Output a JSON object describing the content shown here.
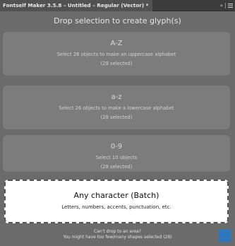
{
  "window": {
    "tab_title": "Fontself Maker 3.5.8 – Untitled – Regular (Vector) *",
    "collapse_glyph": "»",
    "menu_icon": "hamburger-menu-icon"
  },
  "header": {
    "title": "Drop selection to create glyph(s)"
  },
  "cards": {
    "uppercase": {
      "title": "A-Z",
      "description": "Select 26 objects to make an uppercase alphabet",
      "count": "(28 selected)"
    },
    "lowercase": {
      "title": "a-z",
      "description": "Select 26 objects to make a lowercase alphabet",
      "count": "(28 selected)"
    },
    "digits": {
      "title": "0-9",
      "description": "Select 10 objects",
      "count": "(28 selected)"
    },
    "batch": {
      "title": "Any character (Batch)",
      "description": "Letters, numbers, accents, punctuation, etc."
    }
  },
  "footer": {
    "line1": "Can't drop to an area?",
    "line2": "You might have too few/many shapes selected (28)"
  },
  "colors": {
    "panel_background": "#6b6b6b",
    "card_background": "#7c7c7c",
    "batch_background": "#ffffff",
    "logo_accent": "#2f76ba"
  }
}
